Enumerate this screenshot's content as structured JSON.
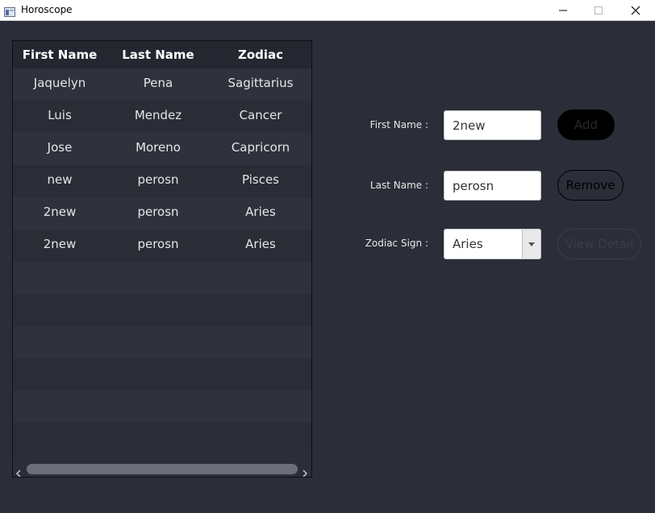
{
  "window": {
    "title": "Horoscope",
    "controls": [
      "minimize",
      "maximize",
      "close"
    ]
  },
  "table": {
    "columns": [
      "First Name",
      "Last Name",
      "Zodiac"
    ],
    "rows": [
      {
        "first": "Jaquelyn",
        "last": "Pena",
        "zodiac": "Sagittarius"
      },
      {
        "first": "Luis",
        "last": "Mendez",
        "zodiac": "Cancer"
      },
      {
        "first": "Jose",
        "last": "Moreno",
        "zodiac": "Capricorn"
      },
      {
        "first": "new",
        "last": "perosn",
        "zodiac": "Pisces"
      },
      {
        "first": "2new",
        "last": "perosn",
        "zodiac": "Aries"
      },
      {
        "first": "2new",
        "last": "perosn",
        "zodiac": "Aries"
      },
      {
        "first": "",
        "last": "",
        "zodiac": ""
      },
      {
        "first": "",
        "last": "",
        "zodiac": ""
      },
      {
        "first": "",
        "last": "",
        "zodiac": ""
      },
      {
        "first": "",
        "last": "",
        "zodiac": ""
      },
      {
        "first": "",
        "last": "",
        "zodiac": ""
      },
      {
        "first": "",
        "last": "",
        "zodiac": ""
      }
    ]
  },
  "form": {
    "first_name_label": "First Name :",
    "first_name_value": "2new",
    "last_name_label": "Last Name :",
    "last_name_value": "perosn",
    "zodiac_label": "Zodiac Sign :",
    "zodiac_value": "Aries"
  },
  "buttons": {
    "add": "Add",
    "remove": "Remove",
    "view_detail": "View Detail"
  },
  "colors": {
    "background": "#2b2e38",
    "header": "#242730",
    "row_odd": "#2f323d",
    "row_even": "#2a2d36"
  }
}
